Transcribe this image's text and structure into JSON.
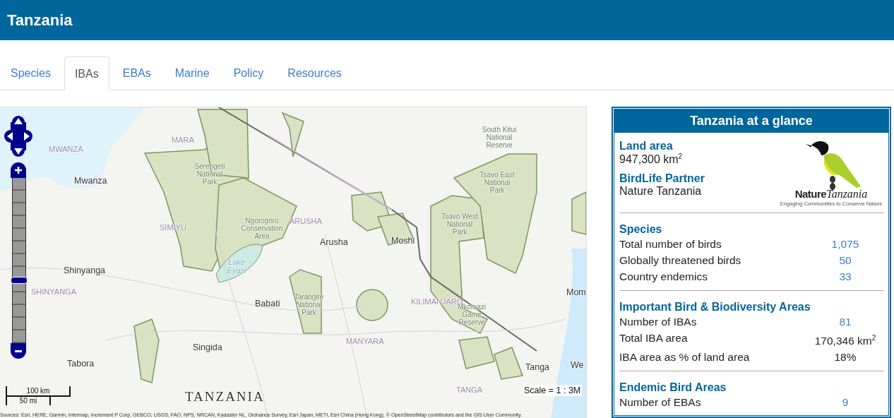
{
  "header": {
    "title": "Tanzania"
  },
  "tabs": [
    {
      "label": "Species",
      "selected": false
    },
    {
      "label": "IBAs",
      "selected": true
    },
    {
      "label": "EBAs",
      "selected": false
    },
    {
      "label": "Marine",
      "selected": false
    },
    {
      "label": "Policy",
      "selected": false
    },
    {
      "label": "Resources",
      "selected": false
    }
  ],
  "map": {
    "labels": [
      {
        "text": "MWANZA",
        "kind": "region"
      },
      {
        "text": "MARA",
        "kind": "region"
      },
      {
        "text": "South Kitui National Reserve",
        "kind": "park"
      },
      {
        "text": "Mwanza",
        "kind": "city"
      },
      {
        "text": "Serengeti National Park",
        "kind": "park"
      },
      {
        "text": "Tsavo East National Park",
        "kind": "park"
      },
      {
        "text": "SIMIYU",
        "kind": "region"
      },
      {
        "text": "Ngorogoro Conservation Area",
        "kind": "park"
      },
      {
        "text": "ARUSHA",
        "kind": "region"
      },
      {
        "text": "Arusha",
        "kind": "city"
      },
      {
        "text": "Moshi",
        "kind": "city"
      },
      {
        "text": "Tsavo West National Park",
        "kind": "park"
      },
      {
        "text": "Shinyanga",
        "kind": "city"
      },
      {
        "text": "Lake Eyasi",
        "kind": "water"
      },
      {
        "text": "SHINYANGA",
        "kind": "region"
      },
      {
        "text": "Babati",
        "kind": "city"
      },
      {
        "text": "Tarangire National Park",
        "kind": "park"
      },
      {
        "text": "KILIMANJARO",
        "kind": "region"
      },
      {
        "text": "Mkomazi Game Reserve",
        "kind": "park"
      },
      {
        "text": "Mom",
        "kind": "city"
      },
      {
        "text": "Singida",
        "kind": "city"
      },
      {
        "text": "MANYARA",
        "kind": "region"
      },
      {
        "text": "Tabora",
        "kind": "city"
      },
      {
        "text": "Tanga",
        "kind": "city"
      },
      {
        "text": "We",
        "kind": "city"
      },
      {
        "text": "TANZANIA",
        "kind": "country"
      },
      {
        "text": "TANGA",
        "kind": "region"
      }
    ],
    "zoom": {
      "level": 0.38
    },
    "scale_bar": {
      "metric": "100 km",
      "imperial": "50 mi"
    },
    "scale": "Scale = 1 : 3M",
    "attribution": "Sources: Esri, HERE, Garmin, Intermap, Increment P Corp, GEBCO, USGS, FAO, NPS, NRCAN, Kadaster NL, Ordnance Survey, Esri Japan, METI, Esri China (Hong Kong), © OpenStreetMap contributors and the GIS User Community."
  },
  "panel": {
    "title": "Tanzania at a glance",
    "overview": [
      {
        "heading": "Land area",
        "value": "947,300 km$^{2}$"
      },
      {
        "heading": "BirdLife Partner",
        "value": "Nature Tanzania"
      }
    ],
    "logo": {
      "word_1": "Nature",
      "word_2": "Tanzania",
      "tagline": "Engaging Communities to Conserve Nature"
    },
    "sections": [
      {
        "heading": "Species",
        "rows": [
          {
            "label": "Total number of birds",
            "value": "1,075",
            "link": true
          },
          {
            "label": "Globally threatened birds",
            "value": "50",
            "link": true
          },
          {
            "label": "Country endemics",
            "value": "33",
            "link": true
          }
        ]
      },
      {
        "heading": "Important Bird & Biodiversity Areas",
        "rows": [
          {
            "label": "Number of IBAs",
            "value": "81",
            "link": true
          },
          {
            "label": "Total IBA area",
            "value": "170,346 km$^{2}$",
            "link": false
          },
          {
            "label": "IBA area as % of land area",
            "value": "18%",
            "link": false
          }
        ]
      },
      {
        "heading": "Endemic Bird Areas",
        "rows": [
          {
            "label": "Number of EBAs",
            "value": "9",
            "link": true
          }
        ]
      }
    ]
  }
}
